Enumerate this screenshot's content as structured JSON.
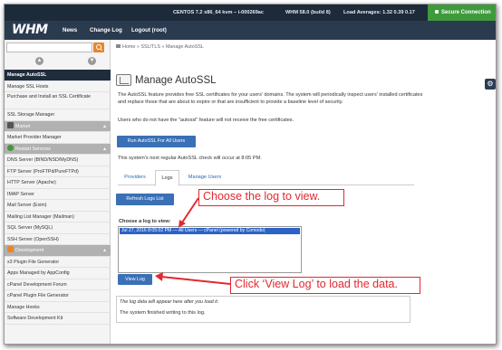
{
  "statusbar": {
    "os": "CENTOS 7.2 x86_64 kvm – i-000269ac",
    "whm_version": "WHM 58.0 (build 8)",
    "load": "Load Averages: 1.32 0.39 0.17",
    "secure": "Secure Connection"
  },
  "navbar": {
    "logo": "WHM",
    "links": [
      "News",
      "Change Log",
      "Logout (root)"
    ]
  },
  "sidebar": {
    "items": [
      "Manage AutoSSL",
      "Manage SSL Hosts",
      "Purchase and Install an SSL Certificate",
      "SSL Storage Manager",
      "Market",
      "Market Provider Manager",
      "Restart Services",
      "DNS Server (BIND/NSD/MyDNS)",
      "FTP Server (ProFTPd/PureFTPd)",
      "HTTP Server (Apache)",
      "IMAP Server",
      "Mail Server (Exim)",
      "Mailing List Manager (Mailman)",
      "SQL Server (MySQL)",
      "SSH Server (OpenSSH)",
      "Development",
      "x3 Plugin File Generator",
      "Apps Managed by AppConfig",
      "cPanel Development Forum",
      "cPanel Plugin File Generator",
      "Manage Hooks",
      "Software Development Kit"
    ]
  },
  "breadcrumb": "Home » SSL/TLS » Manage AutoSSL",
  "page": {
    "title": "Manage AutoSSL",
    "description": "The AutoSSL feature provides free SSL certificates for your users' domains. The system will periodically inspect users' installed certificates and replace those that are about to expire or that are insufficient to provide a baseline level of security.",
    "note": "Users who do not have the \"autossl\" feature will not receive the free certificates.",
    "run_button": "Run AutoSSL For All Users",
    "next_check": "This system's next regular AutoSSL check will occur at 8:05 PM.",
    "tabs": [
      "Providers",
      "Logs",
      "Manage Users"
    ],
    "refresh_button": "Refresh Logs List",
    "choose_label": "Choose a log to view:",
    "log_option": "Jul 27, 2016 8:05:02 PM — All Users — cPanel (powered by Comodo)",
    "view_button": "View Log",
    "log_placeholder": "The log data will appear here after you load it.",
    "log_output": "The system finished writing to this log."
  },
  "callouts": {
    "choose": "Choose the log to view.",
    "view": "Click ‘View Log’ to load the data."
  },
  "colors": {
    "nav": "#2a3b50",
    "status": "#1d2a3a",
    "button": "#3a70b5",
    "secure": "#3f9a3c",
    "callout": "#e2282e",
    "selection": "#2b63c6"
  }
}
